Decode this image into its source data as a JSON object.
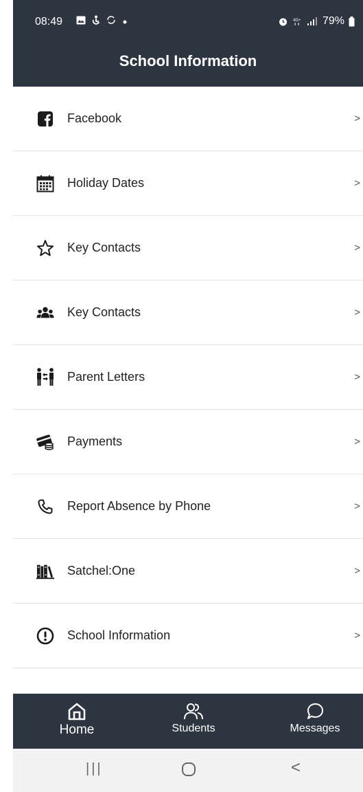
{
  "status_bar": {
    "time": "08:49",
    "left_icons": [
      "gallery-icon",
      "accessibility-icon",
      "sync-icon",
      "dot-icon"
    ],
    "battery": "79%",
    "right_icons": [
      "alarm-icon",
      "4g-icon",
      "signal-icon",
      "battery-icon"
    ]
  },
  "header": {
    "title": "School Information"
  },
  "items": [
    {
      "label": "Facebook",
      "icon": "facebook-icon",
      "chevron": ">"
    },
    {
      "label": "Holiday Dates",
      "icon": "calendar-icon",
      "chevron": ">"
    },
    {
      "label": "Key Contacts",
      "icon": "star-icon",
      "chevron": ">"
    },
    {
      "label": "Key Contacts",
      "icon": "users-icon",
      "chevron": ">"
    },
    {
      "label": "Parent Letters",
      "icon": "parent-child-icon",
      "chevron": ">"
    },
    {
      "label": "Payments",
      "icon": "payments-icon",
      "chevron": ">"
    },
    {
      "label": "Report Absence by Phone",
      "icon": "phone-icon",
      "chevron": ">"
    },
    {
      "label": "Satchel:One",
      "icon": "books-icon",
      "chevron": ">"
    },
    {
      "label": "School Information",
      "icon": "info-icon",
      "chevron": ">"
    }
  ],
  "bottom_nav": [
    {
      "label": "Home",
      "icon": "home-icon",
      "active": true
    },
    {
      "label": "Students",
      "icon": "students-icon",
      "active": false
    },
    {
      "label": "Messages",
      "icon": "messages-icon",
      "active": false
    }
  ],
  "system_nav": {
    "recents": "|||",
    "home": "○",
    "back": "<"
  },
  "colors": {
    "bar": "#2d3640",
    "divider": "#e2e2e2",
    "text": "#222222"
  }
}
